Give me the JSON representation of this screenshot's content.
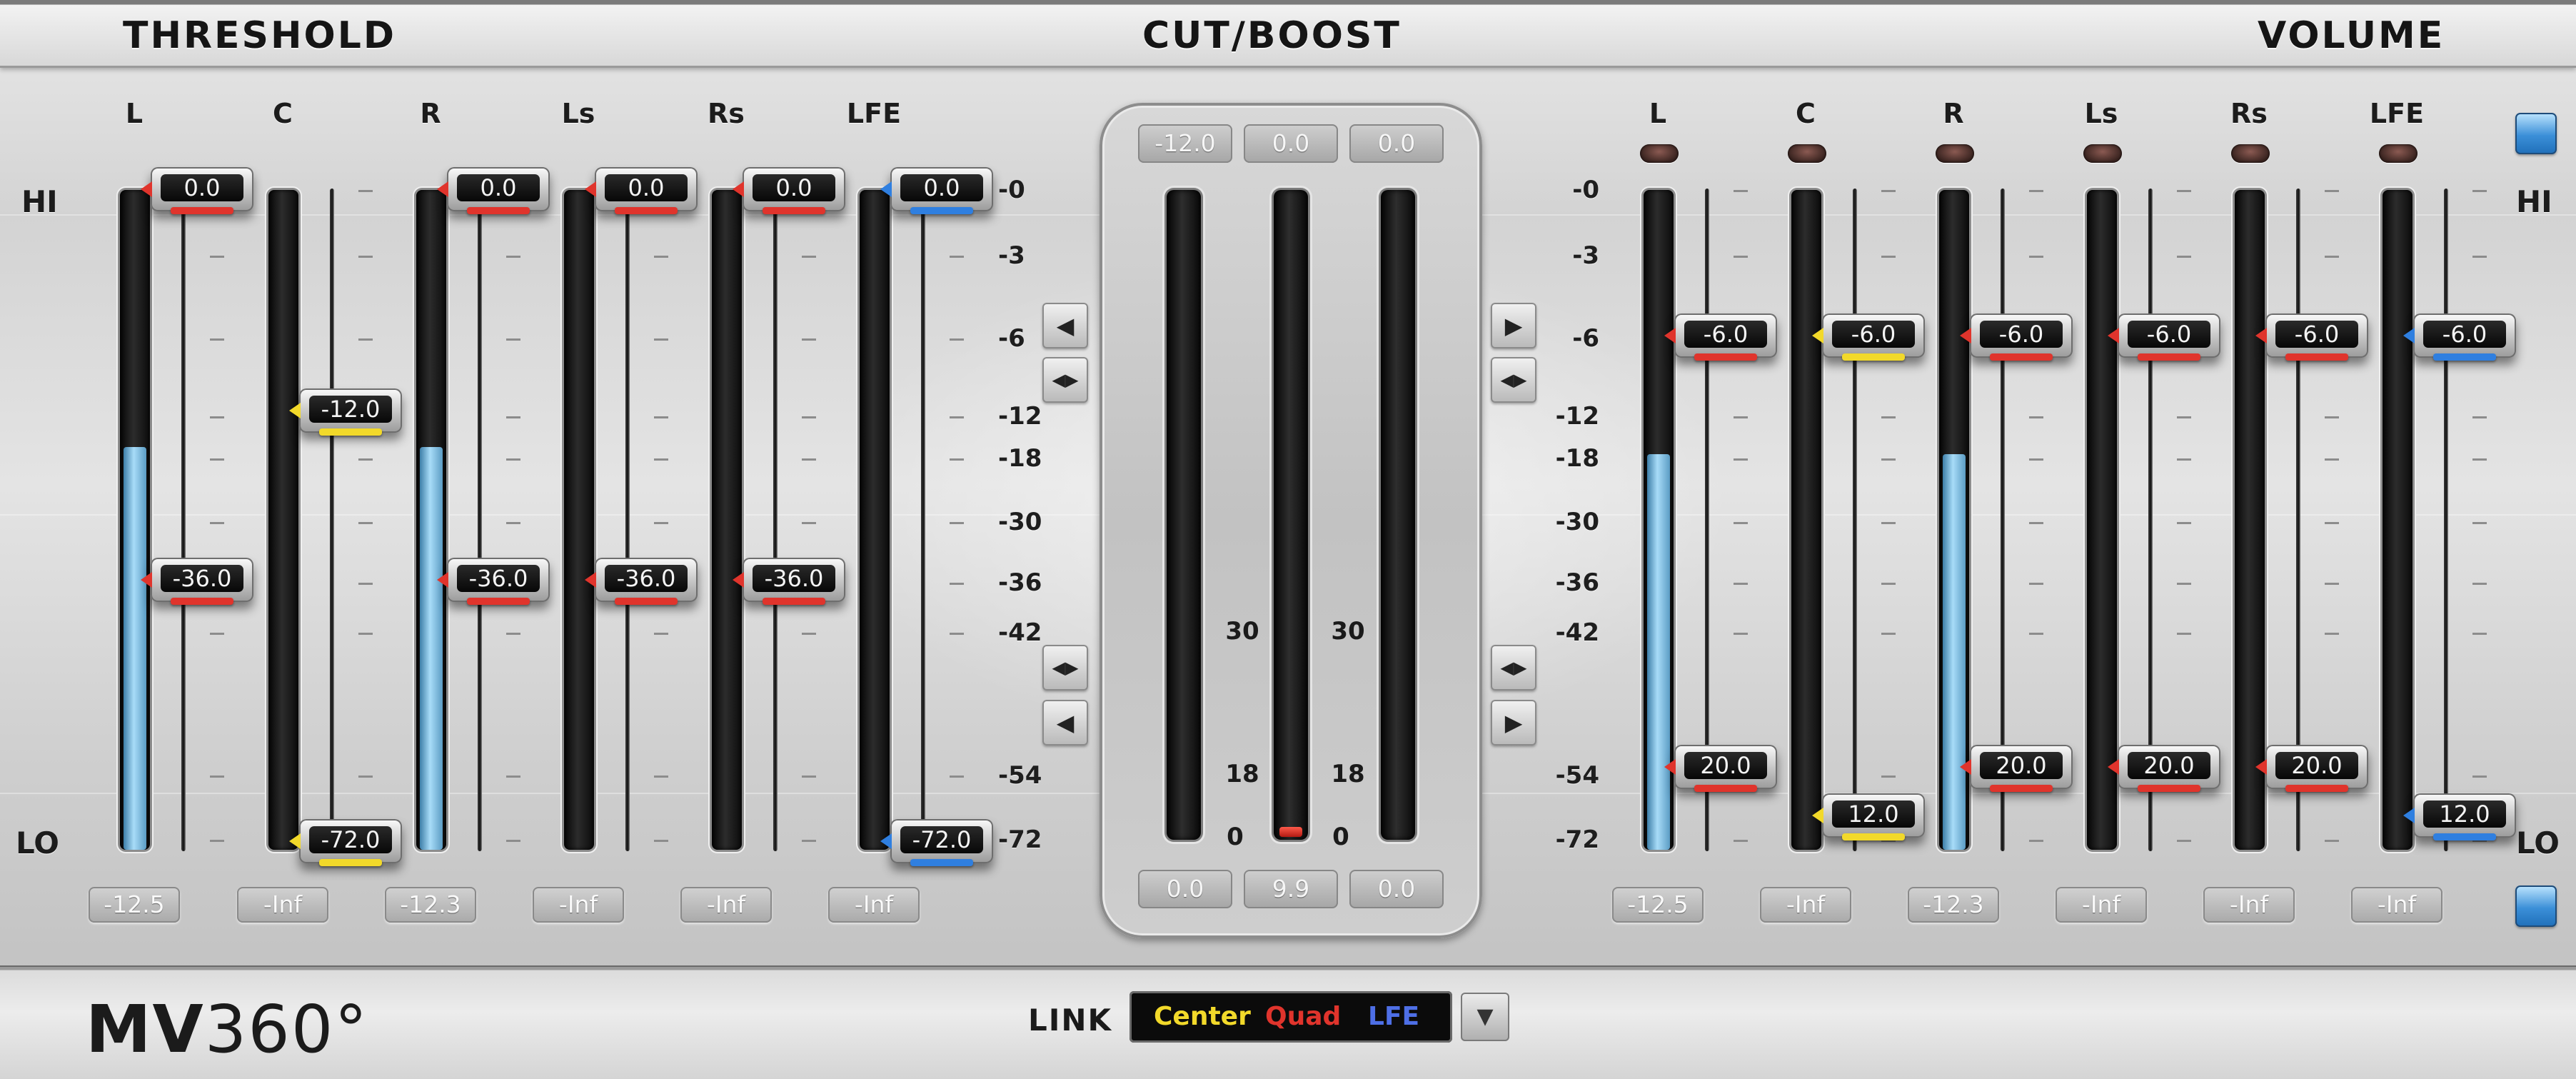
{
  "header": {
    "threshold_title": "THRESHOLD",
    "cut_boost_title": "CUT/BOOST",
    "volume_title": "VOLUME"
  },
  "colors": {
    "red": "#e0342c",
    "yellow": "#f2d92a",
    "blue": "#2f7fe0",
    "meter_fill": "#9fd6f5"
  },
  "side_labels": {
    "hi": "HI",
    "lo": "LO"
  },
  "threshold": {
    "scale": [
      "-0",
      "-3",
      "-6",
      "-12",
      "-18",
      "-30",
      "-36",
      "-42",
      "-54",
      "-72"
    ],
    "channels": [
      {
        "label": "L",
        "color": "red",
        "hi": "0.0",
        "lo": "-36.0",
        "level": 0.61,
        "readout": "-12.5"
      },
      {
        "label": "C",
        "color": "yellow",
        "hi": "-12.0",
        "lo": "-72.0",
        "level": 0.0,
        "readout": "-Inf"
      },
      {
        "label": "R",
        "color": "red",
        "hi": "0.0",
        "lo": "-36.0",
        "level": 0.61,
        "readout": "-12.3"
      },
      {
        "label": "Ls",
        "color": "red",
        "hi": "0.0",
        "lo": "-36.0",
        "level": 0.0,
        "readout": "-Inf"
      },
      {
        "label": "Rs",
        "color": "red",
        "hi": "0.0",
        "lo": "-36.0",
        "level": 0.0,
        "readout": "-Inf"
      },
      {
        "label": "LFE",
        "color": "blue",
        "hi": "0.0",
        "lo": "-72.0",
        "level": 0.0,
        "readout": "-Inf"
      }
    ]
  },
  "cut_boost": {
    "top_readouts": [
      "-12.0",
      "0.0",
      "0.0"
    ],
    "bottom_readouts": [
      "0.0",
      "9.9",
      "0.0"
    ],
    "scale_labels": {
      "n30": "30",
      "n18": "18",
      "n0": "0"
    },
    "buttons": {
      "left_up": "◀",
      "left_both_top": "◀▶",
      "left_both_bottom": "◀▶",
      "left_down": "◀",
      "right_up": "▶",
      "right_both_top": "◀▶",
      "right_both_bottom": "◀▶",
      "right_down": "▶"
    }
  },
  "volume": {
    "scale": [
      "-0",
      "-3",
      "-6",
      "-12",
      "-18",
      "-30",
      "-36",
      "-42",
      "-54",
      "-72"
    ],
    "channels": [
      {
        "label": "L",
        "color": "red",
        "hi": "-6.0",
        "lo": "20.0",
        "level": 0.6,
        "readout": "-12.5"
      },
      {
        "label": "C",
        "color": "yellow",
        "hi": "-6.0",
        "lo": "12.0",
        "level": 0.0,
        "readout": "-Inf"
      },
      {
        "label": "R",
        "color": "red",
        "hi": "-6.0",
        "lo": "20.0",
        "level": 0.6,
        "readout": "-12.3"
      },
      {
        "label": "Ls",
        "color": "red",
        "hi": "-6.0",
        "lo": "20.0",
        "level": 0.0,
        "readout": "-Inf"
      },
      {
        "label": "Rs",
        "color": "red",
        "hi": "-6.0",
        "lo": "20.0",
        "level": 0.0,
        "readout": "-Inf"
      },
      {
        "label": "LFE",
        "color": "blue",
        "hi": "-6.0",
        "lo": "12.0",
        "level": 0.0,
        "readout": "-Inf"
      }
    ]
  },
  "footer": {
    "logo_bold": "MV",
    "logo_light": "360°",
    "link_label": "LINK",
    "link_center": "Center",
    "link_quad": "Quad",
    "link_lfe": "LFE",
    "link_dropdown": "▼"
  }
}
